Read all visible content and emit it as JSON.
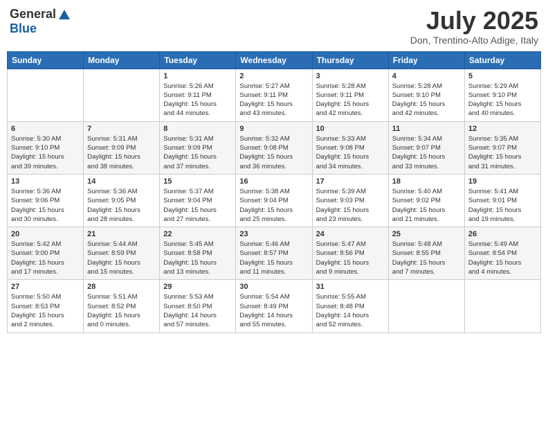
{
  "header": {
    "logo_general": "General",
    "logo_blue": "Blue",
    "month_title": "July 2025",
    "location": "Don, Trentino-Alto Adige, Italy"
  },
  "columns": [
    "Sunday",
    "Monday",
    "Tuesday",
    "Wednesday",
    "Thursday",
    "Friday",
    "Saturday"
  ],
  "weeks": [
    [
      {
        "day": "",
        "info": ""
      },
      {
        "day": "",
        "info": ""
      },
      {
        "day": "1",
        "info": "Sunrise: 5:26 AM\nSunset: 9:11 PM\nDaylight: 15 hours\nand 44 minutes."
      },
      {
        "day": "2",
        "info": "Sunrise: 5:27 AM\nSunset: 9:11 PM\nDaylight: 15 hours\nand 43 minutes."
      },
      {
        "day": "3",
        "info": "Sunrise: 5:28 AM\nSunset: 9:11 PM\nDaylight: 15 hours\nand 42 minutes."
      },
      {
        "day": "4",
        "info": "Sunrise: 5:28 AM\nSunset: 9:10 PM\nDaylight: 15 hours\nand 42 minutes."
      },
      {
        "day": "5",
        "info": "Sunrise: 5:29 AM\nSunset: 9:10 PM\nDaylight: 15 hours\nand 40 minutes."
      }
    ],
    [
      {
        "day": "6",
        "info": "Sunrise: 5:30 AM\nSunset: 9:10 PM\nDaylight: 15 hours\nand 39 minutes."
      },
      {
        "day": "7",
        "info": "Sunrise: 5:31 AM\nSunset: 9:09 PM\nDaylight: 15 hours\nand 38 minutes."
      },
      {
        "day": "8",
        "info": "Sunrise: 5:31 AM\nSunset: 9:09 PM\nDaylight: 15 hours\nand 37 minutes."
      },
      {
        "day": "9",
        "info": "Sunrise: 5:32 AM\nSunset: 9:08 PM\nDaylight: 15 hours\nand 36 minutes."
      },
      {
        "day": "10",
        "info": "Sunrise: 5:33 AM\nSunset: 9:08 PM\nDaylight: 15 hours\nand 34 minutes."
      },
      {
        "day": "11",
        "info": "Sunrise: 5:34 AM\nSunset: 9:07 PM\nDaylight: 15 hours\nand 33 minutes."
      },
      {
        "day": "12",
        "info": "Sunrise: 5:35 AM\nSunset: 9:07 PM\nDaylight: 15 hours\nand 31 minutes."
      }
    ],
    [
      {
        "day": "13",
        "info": "Sunrise: 5:36 AM\nSunset: 9:06 PM\nDaylight: 15 hours\nand 30 minutes."
      },
      {
        "day": "14",
        "info": "Sunrise: 5:36 AM\nSunset: 9:05 PM\nDaylight: 15 hours\nand 28 minutes."
      },
      {
        "day": "15",
        "info": "Sunrise: 5:37 AM\nSunset: 9:04 PM\nDaylight: 15 hours\nand 27 minutes."
      },
      {
        "day": "16",
        "info": "Sunrise: 5:38 AM\nSunset: 9:04 PM\nDaylight: 15 hours\nand 25 minutes."
      },
      {
        "day": "17",
        "info": "Sunrise: 5:39 AM\nSunset: 9:03 PM\nDaylight: 15 hours\nand 23 minutes."
      },
      {
        "day": "18",
        "info": "Sunrise: 5:40 AM\nSunset: 9:02 PM\nDaylight: 15 hours\nand 21 minutes."
      },
      {
        "day": "19",
        "info": "Sunrise: 5:41 AM\nSunset: 9:01 PM\nDaylight: 15 hours\nand 19 minutes."
      }
    ],
    [
      {
        "day": "20",
        "info": "Sunrise: 5:42 AM\nSunset: 9:00 PM\nDaylight: 15 hours\nand 17 minutes."
      },
      {
        "day": "21",
        "info": "Sunrise: 5:44 AM\nSunset: 8:59 PM\nDaylight: 15 hours\nand 15 minutes."
      },
      {
        "day": "22",
        "info": "Sunrise: 5:45 AM\nSunset: 8:58 PM\nDaylight: 15 hours\nand 13 minutes."
      },
      {
        "day": "23",
        "info": "Sunrise: 5:46 AM\nSunset: 8:57 PM\nDaylight: 15 hours\nand 11 minutes."
      },
      {
        "day": "24",
        "info": "Sunrise: 5:47 AM\nSunset: 8:56 PM\nDaylight: 15 hours\nand 9 minutes."
      },
      {
        "day": "25",
        "info": "Sunrise: 5:48 AM\nSunset: 8:55 PM\nDaylight: 15 hours\nand 7 minutes."
      },
      {
        "day": "26",
        "info": "Sunrise: 5:49 AM\nSunset: 8:54 PM\nDaylight: 15 hours\nand 4 minutes."
      }
    ],
    [
      {
        "day": "27",
        "info": "Sunrise: 5:50 AM\nSunset: 8:53 PM\nDaylight: 15 hours\nand 2 minutes."
      },
      {
        "day": "28",
        "info": "Sunrise: 5:51 AM\nSunset: 8:52 PM\nDaylight: 15 hours\nand 0 minutes."
      },
      {
        "day": "29",
        "info": "Sunrise: 5:53 AM\nSunset: 8:50 PM\nDaylight: 14 hours\nand 57 minutes."
      },
      {
        "day": "30",
        "info": "Sunrise: 5:54 AM\nSunset: 8:49 PM\nDaylight: 14 hours\nand 55 minutes."
      },
      {
        "day": "31",
        "info": "Sunrise: 5:55 AM\nSunset: 8:48 PM\nDaylight: 14 hours\nand 52 minutes."
      },
      {
        "day": "",
        "info": ""
      },
      {
        "day": "",
        "info": ""
      }
    ]
  ]
}
